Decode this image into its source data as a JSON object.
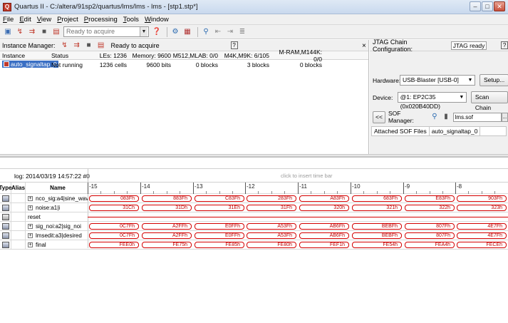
{
  "window": {
    "title": "Quartus II - C:/altera/91sp2/quartus/lms/lms - lms - [stp1.stp*]",
    "app_icon": "Q",
    "min_label": "–",
    "max_label": "□",
    "close_label": "✕"
  },
  "menu": [
    "File",
    "Edit",
    "View",
    "Project",
    "Processing",
    "Tools",
    "Window"
  ],
  "toolbar": {
    "status": "Ready to acquire",
    "icons": [
      "instance-icon",
      "run-icon",
      "autorun-icon",
      "stop-icon",
      "read-data-icon",
      "help-icon",
      "chip-icon",
      "chart-icon",
      "node-icon",
      "back-icon",
      "forward-icon",
      "list-icon"
    ]
  },
  "instance_manager": {
    "label": "Instance Manager:",
    "status": "Ready to acquire",
    "help": "?",
    "close": "×",
    "columns": [
      "Instance",
      "Status",
      "LEs: 1236",
      "Memory: 9600",
      "M512,MLAB: 0/0",
      "M4K,M9K: 6/105",
      "M-RAM,M144K: 0/0"
    ],
    "rows": [
      {
        "instance": "auto_signaltap_0",
        "status": "Not running",
        "les": "1236 cells",
        "memory": "9600 bits",
        "m512": "0 blocks",
        "m4k": "3 blocks",
        "mram": "0 blocks"
      }
    ]
  },
  "jtag": {
    "label": "JTAG Chain Configuration:",
    "status": "JTAG ready",
    "help": "?",
    "hardware_label": "Hardware:",
    "hardware_value": "USB-Blaster [USB-0]",
    "setup_button": "Setup...",
    "device_label": "Device:",
    "device_value": "@1: EP2C35 (0x020B40DD)",
    "scan_button": "Scan Chain",
    "sof_manager_label": "SOF Manager:",
    "sof_toggle": "<<",
    "sof_file": "lms.sof",
    "sof_more": "...",
    "attached_label": "Attached SOF Files",
    "attached_value": "auto_signaltap_0"
  },
  "waveform": {
    "log_label": "log: 2014/03/19 14:57:22  #0",
    "hint": "click to insert time bar",
    "columns": {
      "type": "Type",
      "alias": "Alias",
      "name": "Name"
    },
    "ticks": [
      "-15",
      "-14",
      "-13",
      "-12",
      "-11",
      "-10",
      "-9",
      "-8"
    ],
    "signals": [
      {
        "name": "nco_sig:a4|sine_wav",
        "kind": "bus",
        "values": [
          "083Fh",
          "883Fh",
          "C83Fh",
          "283Fh",
          "A83Fh",
          "683Fh",
          "E83Fh",
          "903Fh"
        ]
      },
      {
        "name": "noise:a1|i",
        "kind": "bus",
        "values": [
          "31Ch",
          "31Dh",
          "31Eh",
          "31Fh",
          "320h",
          "321h",
          "322h",
          "323h"
        ]
      },
      {
        "name": "reset",
        "kind": "line",
        "values": []
      },
      {
        "name": "sig_noi:a2|sig_noi",
        "kind": "bus",
        "values": [
          "0C7Fh",
          "A2FFh",
          "E0FFh",
          "A53Fh",
          "AB6Fh",
          "BEBFh",
          "807Fh",
          "4E7Fh"
        ]
      },
      {
        "name": "lmsedit:a3|desired",
        "kind": "bus",
        "values": [
          "0C7Fh",
          "A2FFh",
          "E0FFh",
          "A53Fh",
          "AB6Fh",
          "BEBFh",
          "807Fh",
          "4E7Fh"
        ]
      },
      {
        "name": "final",
        "kind": "bus",
        "values": [
          "FEE0h",
          "FE75h",
          "FE85h",
          "FE80h",
          "FEF1h",
          "FE54h",
          "FEA4h",
          "FECEh"
        ]
      }
    ]
  }
}
